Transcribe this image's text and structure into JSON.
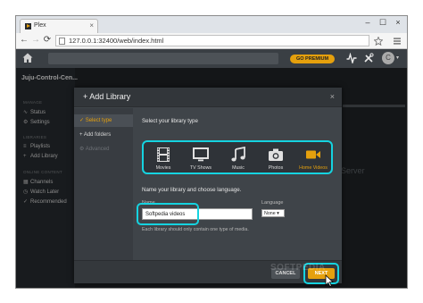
{
  "browser": {
    "tab_title": "Plex",
    "tab_close": "×",
    "url": "127.0.0.1:32400/web/index.html",
    "window_controls": {
      "minimize": "–",
      "maximize": "☐",
      "close": "×"
    },
    "nav": {
      "back": "←",
      "forward": "→",
      "reload": "⟳"
    }
  },
  "topbar": {
    "premium_label": "GO PREMIUM",
    "avatar_letter": "C",
    "accent": "#e5a00d"
  },
  "sidebar": {
    "server_name": "Juju-Control-Cen...",
    "manage_heading": "MANAGE",
    "manage_items": [
      {
        "icon": "pulse-icon",
        "label": "Status"
      },
      {
        "icon": "gear-icon",
        "label": "Settings"
      }
    ],
    "libraries_heading": "LIBRARIES",
    "library_items": [
      {
        "icon": "playlist-icon",
        "label": "Playlists"
      },
      {
        "icon": "plus-icon",
        "label": "Add Library"
      }
    ],
    "online_heading": "ONLINE CONTENT",
    "online_items": [
      {
        "icon": "channels-icon",
        "label": "Channels"
      },
      {
        "icon": "clock-icon",
        "label": "Watch Later"
      },
      {
        "icon": "thumbs-up-icon",
        "label": "Recommended"
      }
    ]
  },
  "background_text": "Server",
  "dialog": {
    "title": "+ Add Library",
    "close": "×",
    "steps": [
      {
        "label": "✓ Select type",
        "state": "active"
      },
      {
        "label": "+ Add folders",
        "state": "enabled"
      },
      {
        "label": "⚙ Advanced",
        "state": "disabled"
      }
    ],
    "type_prompt": "Select your library type",
    "types": [
      {
        "icon": "film-icon",
        "label": "Movies",
        "selected": false
      },
      {
        "icon": "tv-icon",
        "label": "TV Shows",
        "selected": false
      },
      {
        "icon": "music-note-icon",
        "label": "Music",
        "selected": false
      },
      {
        "icon": "camera-icon",
        "label": "Photos",
        "selected": false
      },
      {
        "icon": "video-camera-icon",
        "label": "Home Videos",
        "selected": true
      }
    ],
    "name_prompt": "Name your library and choose language.",
    "name_field_label": "Name",
    "name_value": "Softpedia videos",
    "language_label": "Language",
    "language_value": "None ▾",
    "note": "Each library should only contain one type of media.",
    "cancel_label": "CANCEL",
    "next_label": "NEXT",
    "highlight_color": "#15d3e0"
  },
  "watermark": "SOFTPEDIA"
}
